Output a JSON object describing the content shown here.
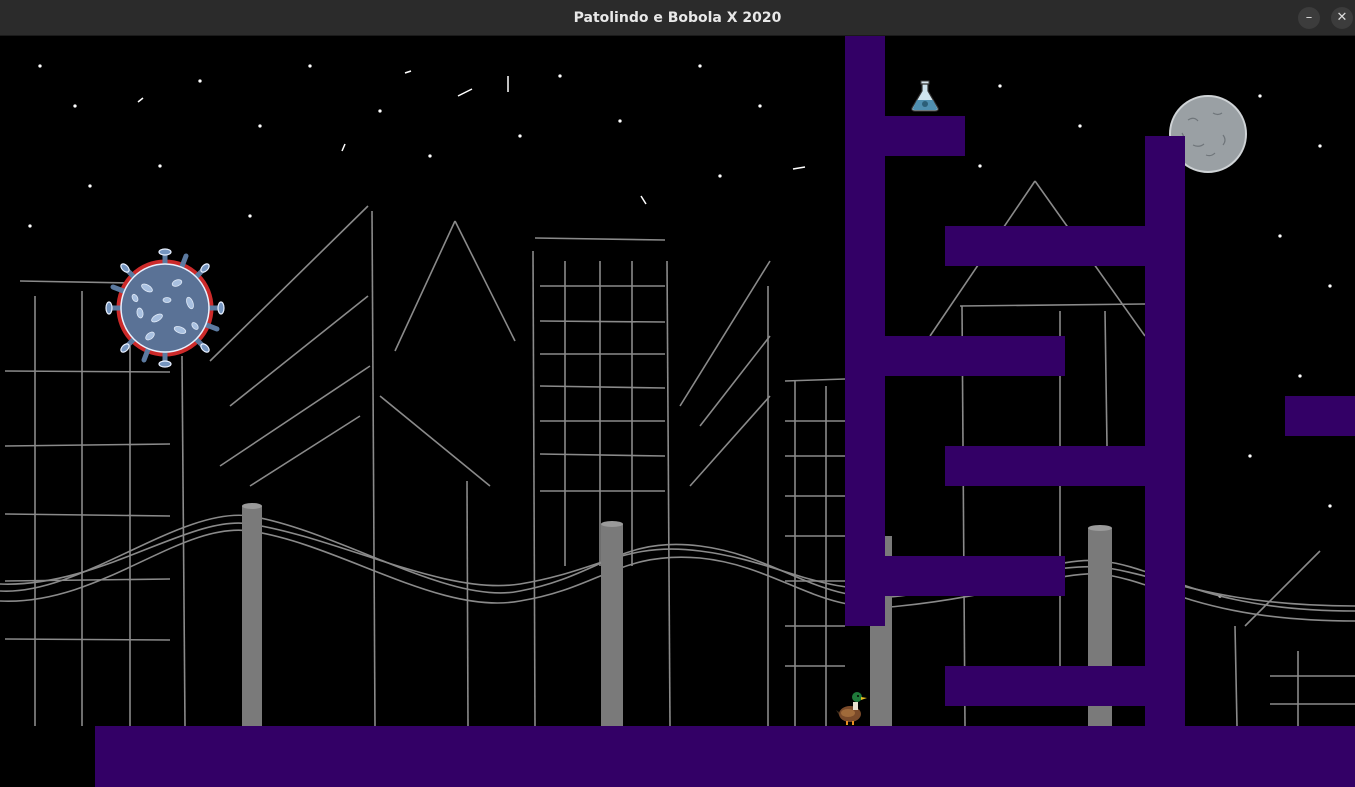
{
  "window": {
    "title": "Patolindo e Bobola X 2020",
    "minimize_icon": "minimize-icon",
    "close_icon": "close-icon"
  },
  "game": {
    "background_color": "#000000",
    "platform_color": "#330066",
    "sprites": [
      "coronavirus-enemy",
      "duck-player",
      "potion-flask",
      "moon"
    ]
  }
}
